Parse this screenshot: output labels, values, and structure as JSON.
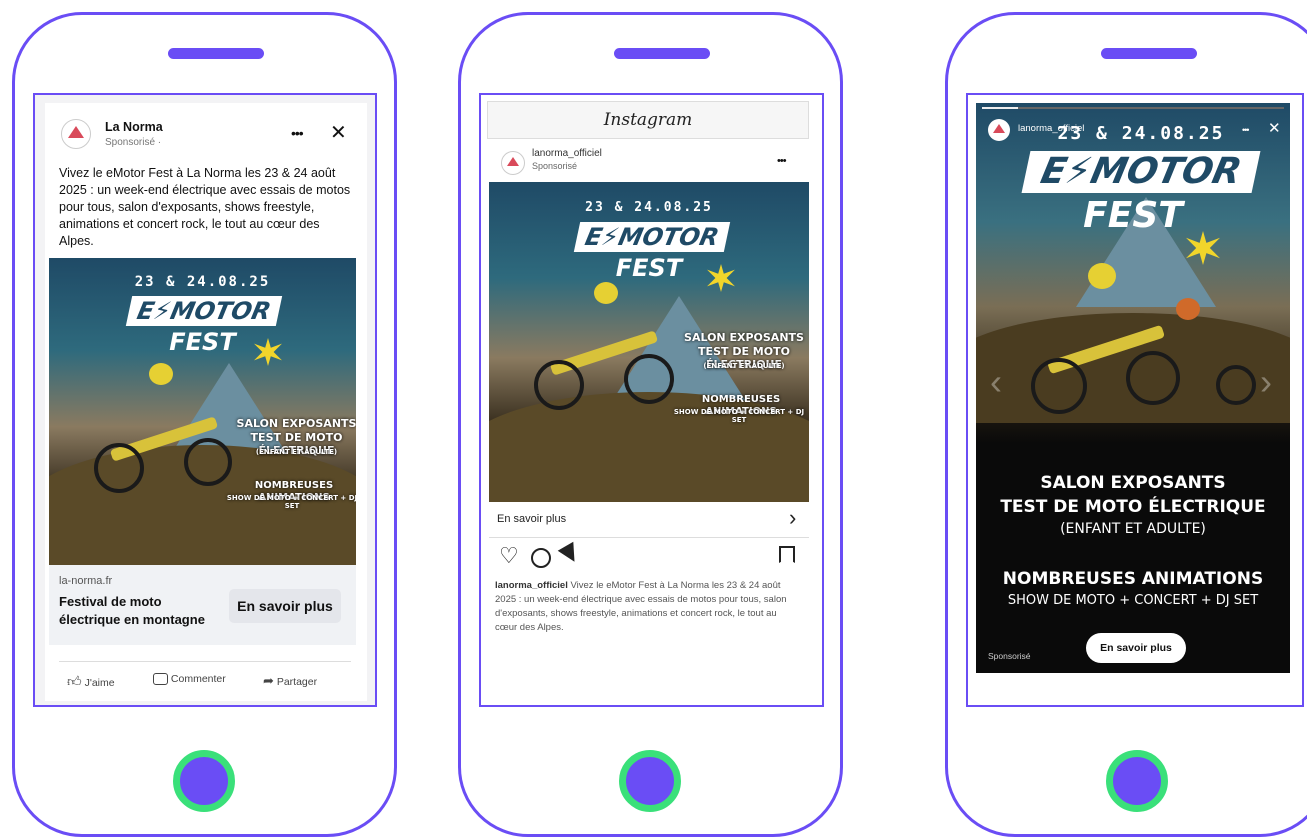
{
  "facebook": {
    "page_name": "La Norma",
    "sponsored": "Sponsorisé · ",
    "more": "•••",
    "close": "✕",
    "post_text": "Vivez le eMotor Fest à La Norma les 23 & 24 août 2025 : un week-end électrique avec essais de motos pour tous, salon d'exposants, shows freestyle, animations et concert rock, le tout au cœur des Alpes.",
    "domain": "la-norma.fr",
    "headline": "Festival de moto électrique en montagne",
    "cta": "En savoir plus",
    "actions": {
      "like": "J'aime",
      "comment": "Commenter",
      "share": "Partager"
    }
  },
  "instagram": {
    "app_title": "Instagram",
    "account": "lanorma_officiel",
    "sponsored": "Sponsorisé",
    "more": "•••",
    "cta": "En savoir plus",
    "chevron": "›",
    "caption_user": "lanorma_officiel",
    "caption": " Vivez le eMotor Fest à La Norma les 23 & 24 août 2025 : un week-end électrique avec essais de motos pour tous, salon d'exposants, shows freestyle, animations et concert rock, le tout au cœur des Alpes."
  },
  "story": {
    "account": "lanorma_officiel",
    "more": "•••",
    "close": "✕",
    "sponsored": "Sponsorisé",
    "cta": "En savoir plus",
    "prev": "‹",
    "next": "›"
  },
  "poster": {
    "dates": "23 & 24.08.25",
    "logo": "E⚡MOTOR",
    "fest": "FEST",
    "line1": "Salon exposants",
    "line2": "Test de moto électrique",
    "line3": "(enfant et adulte)",
    "line4": "Nombreuses animations",
    "line5": "Show de moto + concert + DJ set"
  },
  "colors": {
    "frame": "#6a4df5",
    "home_ring": "#3ae07a",
    "poster_sky": "#1f4a66"
  }
}
